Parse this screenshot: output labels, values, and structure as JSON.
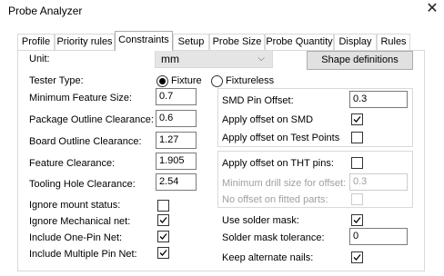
{
  "window": {
    "title": "Probe Analyzer",
    "close_glyph": "✕"
  },
  "tabs": [
    {
      "label": "Profile",
      "active": false
    },
    {
      "label": "Priority rules",
      "active": false
    },
    {
      "label": "Constraints",
      "active": true
    },
    {
      "label": "Setup",
      "active": false
    },
    {
      "label": "Probe Size",
      "active": false
    },
    {
      "label": "Probe Quantity",
      "active": false
    },
    {
      "label": "Display",
      "active": false
    },
    {
      "label": "Rules",
      "active": false
    }
  ],
  "unit": {
    "label": "Unit:",
    "value": "mm",
    "chevron": "⌵"
  },
  "shape_definitions_button": "Shape definitions",
  "tester_type": {
    "label": "Tester Type:",
    "options": [
      {
        "label": "Fixture",
        "selected": true
      },
      {
        "label": "Fixtureless",
        "selected": false
      }
    ]
  },
  "left_fields": [
    {
      "label": "Minimum Feature Size:",
      "value": "0.7"
    },
    {
      "label": "Package Outline Clearance:",
      "value": "0.6"
    },
    {
      "label": "Board Outline Clearance:",
      "value": "1.27"
    },
    {
      "label": "Feature Clearance:",
      "value": "1.905"
    },
    {
      "label": "Tooling Hole Clearance:",
      "value": "2.54"
    }
  ],
  "left_checks": [
    {
      "label": "Ignore mount status:",
      "checked": false
    },
    {
      "label": "Ignore Mechanical net:",
      "checked": true
    },
    {
      "label": "Include One-Pin Net:",
      "checked": true
    },
    {
      "label": "Include Multiple Pin Net:",
      "checked": true
    }
  ],
  "smd_group": {
    "pin_offset_label": "SMD Pin Offset:",
    "pin_offset_value": "0.3",
    "apply_smd_label": "Apply offset on SMD",
    "apply_smd_checked": true,
    "apply_test_points_label": "Apply offset on Test Points",
    "apply_test_points_checked": false
  },
  "tht_group": {
    "apply_tht_label": "Apply offset on THT pins:",
    "apply_tht_checked": false,
    "min_drill_label": "Minimum drill size for offset:",
    "min_drill_value": "0.3",
    "no_offset_fitted_label": "No offset on fitted parts:",
    "no_offset_fitted_checked": false
  },
  "solder_group": {
    "use_solder_mask_label": "Use solder mask:",
    "use_solder_mask_checked": true,
    "tolerance_label": "Solder mask tolerance:",
    "tolerance_value": "0",
    "keep_alternate_label": "Keep alternate nails:",
    "keep_alternate_checked": true
  }
}
